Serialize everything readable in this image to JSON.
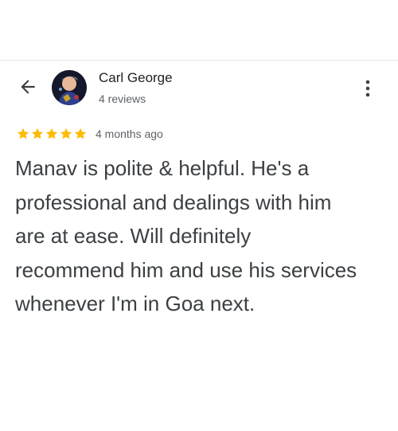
{
  "review": {
    "author_name": "Carl George",
    "author_reviews": "4 reviews",
    "rating": 5,
    "rating_max": 5,
    "star_color": "#fbbc04",
    "time_ago": "4 months ago",
    "text": "Manav is polite & helpful. He's a professional and dealings with him are at ease. Will definitely recommend him and use his services whenever I'm in Goa next."
  },
  "icons": {
    "back": "arrow-back-icon",
    "menu": "more-vert-icon",
    "star": "star-icon"
  }
}
